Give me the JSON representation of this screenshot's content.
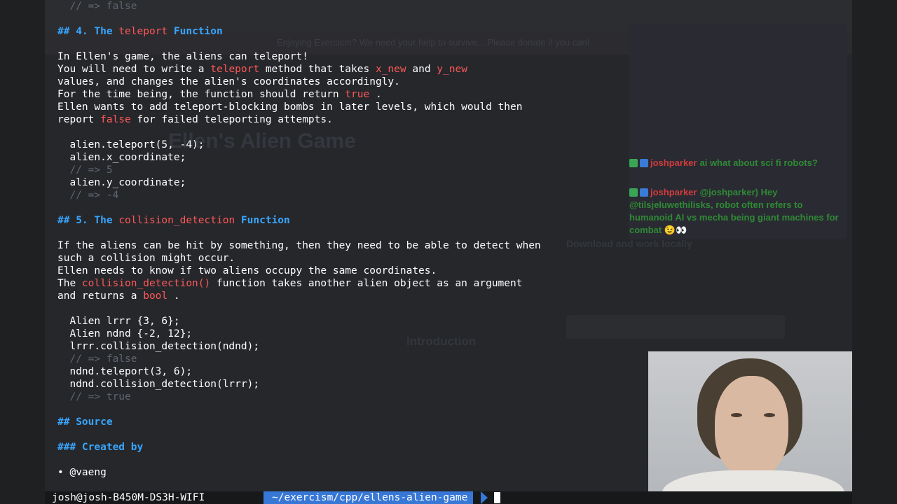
{
  "background": {
    "banner_text": "Enjoying Exercism? We need your help to survive... Please donate if you can!",
    "page_title": "Ellen's Alien Game",
    "section_title": "Introduction",
    "side_title": "Download and work locally"
  },
  "chat": [
    {
      "user": "joshparker",
      "message": "ai what about sci fi robots?",
      "emoji": ""
    },
    {
      "user": "joshparker",
      "message": "@joshparker) Hey @tilsjeluwethilisks, robot often refers to humanoid AI vs mecha being giant machines for combat",
      "emoji": "😉👀"
    }
  ],
  "terminal": {
    "lines": [
      {
        "segments": [
          {
            "t": "  // => false",
            "c": "dim"
          }
        ]
      },
      {
        "segments": []
      },
      {
        "segments": [
          {
            "t": "## 4. The ",
            "c": "h"
          },
          {
            "t": "teleport",
            "c": "hl"
          },
          {
            "t": " Function",
            "c": "h"
          }
        ]
      },
      {
        "segments": []
      },
      {
        "segments": [
          {
            "t": "In Ellen's game, the aliens can teleport!",
            "c": ""
          }
        ]
      },
      {
        "segments": [
          {
            "t": "You will need to write a ",
            "c": ""
          },
          {
            "t": "teleport",
            "c": "hl"
          },
          {
            "t": " method that takes ",
            "c": ""
          },
          {
            "t": "x_new",
            "c": "hl"
          },
          {
            "t": " and ",
            "c": ""
          },
          {
            "t": "y_new",
            "c": "hl"
          }
        ]
      },
      {
        "segments": [
          {
            "t": "values, and changes the alien's coordinates accordingly.",
            "c": ""
          }
        ]
      },
      {
        "segments": [
          {
            "t": "For the time being, the function should return ",
            "c": ""
          },
          {
            "t": "true",
            "c": "hl"
          },
          {
            "t": " .",
            "c": ""
          }
        ]
      },
      {
        "segments": [
          {
            "t": "Ellen wants to add teleport-blocking bombs in later levels, which would then",
            "c": ""
          }
        ]
      },
      {
        "segments": [
          {
            "t": "report ",
            "c": ""
          },
          {
            "t": "false",
            "c": "hl"
          },
          {
            "t": " for failed teleporting attempts.",
            "c": ""
          }
        ]
      },
      {
        "segments": []
      },
      {
        "segments": [
          {
            "t": "  alien.teleport(5, -4);",
            "c": ""
          }
        ]
      },
      {
        "segments": [
          {
            "t": "  alien.x_coordinate;",
            "c": ""
          }
        ]
      },
      {
        "segments": [
          {
            "t": "  // => 5",
            "c": "dim"
          }
        ]
      },
      {
        "segments": [
          {
            "t": "  alien.y_coordinate;",
            "c": ""
          }
        ]
      },
      {
        "segments": [
          {
            "t": "  // => -4",
            "c": "dim"
          }
        ]
      },
      {
        "segments": []
      },
      {
        "segments": [
          {
            "t": "## 5. The ",
            "c": "h"
          },
          {
            "t": "collision_detection",
            "c": "hl"
          },
          {
            "t": " Function",
            "c": "h"
          }
        ]
      },
      {
        "segments": []
      },
      {
        "segments": [
          {
            "t": "If the aliens can be hit by something, then they need to be able to detect when",
            "c": ""
          }
        ]
      },
      {
        "segments": [
          {
            "t": "such a collision might occur.",
            "c": ""
          }
        ]
      },
      {
        "segments": [
          {
            "t": "Ellen needs to know if two aliens occupy the same coordinates.",
            "c": ""
          }
        ]
      },
      {
        "segments": [
          {
            "t": "The ",
            "c": ""
          },
          {
            "t": "collision_detection()",
            "c": "hl"
          },
          {
            "t": " function takes another alien object as an argument",
            "c": ""
          }
        ]
      },
      {
        "segments": [
          {
            "t": "and returns a ",
            "c": ""
          },
          {
            "t": "bool",
            "c": "hl"
          },
          {
            "t": " .",
            "c": ""
          }
        ]
      },
      {
        "segments": []
      },
      {
        "segments": [
          {
            "t": "  Alien lrrr {3, 6};",
            "c": ""
          }
        ]
      },
      {
        "segments": [
          {
            "t": "  Alien ndnd {-2, 12};",
            "c": ""
          }
        ]
      },
      {
        "segments": [
          {
            "t": "  lrrr.collision_detection(ndnd);",
            "c": ""
          }
        ]
      },
      {
        "segments": [
          {
            "t": "  // => false",
            "c": "dim"
          }
        ]
      },
      {
        "segments": [
          {
            "t": "  ndnd.teleport(3, 6);",
            "c": ""
          }
        ]
      },
      {
        "segments": [
          {
            "t": "  ndnd.collision_detection(lrrr);",
            "c": ""
          }
        ]
      },
      {
        "segments": [
          {
            "t": "  // => true",
            "c": "dim"
          }
        ]
      },
      {
        "segments": []
      },
      {
        "segments": [
          {
            "t": "## Source",
            "c": "h"
          }
        ]
      },
      {
        "segments": []
      },
      {
        "segments": [
          {
            "t": "### Created by",
            "c": "h"
          }
        ]
      },
      {
        "segments": []
      },
      {
        "segments": [
          {
            "t": "• @vaeng",
            "c": ""
          }
        ]
      }
    ]
  },
  "statusbar": {
    "user_host": "josh@josh-B450M-DS3H-WIFI",
    "path": "~/exercism/cpp/ellens-alien-game"
  },
  "colors": {
    "heading": "#39a6ff",
    "highlight": "#ff5858",
    "comment": "#5f6570",
    "path_bg": "#3777d6"
  }
}
